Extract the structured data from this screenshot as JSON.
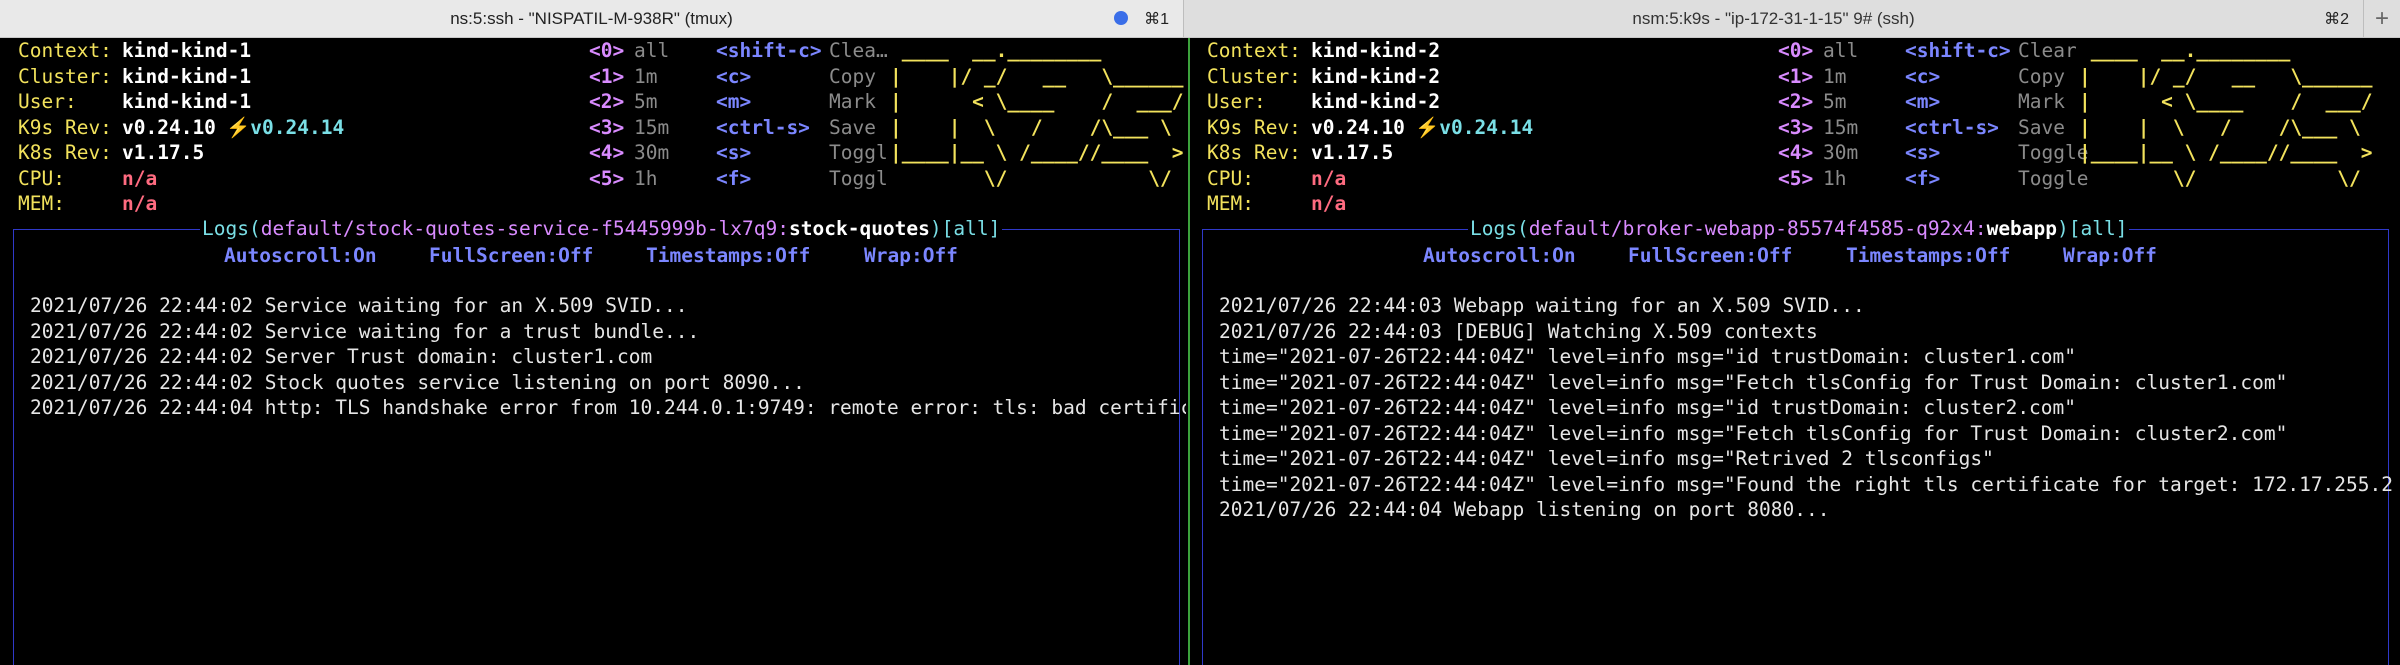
{
  "tabs": [
    {
      "title": "ns:5:ssh - \"NISPATIL-M-938R\" (tmux)",
      "key": "⌘1"
    },
    {
      "title": "nsm:5:k9s - \"ip-172-31-1-15\" 9# (ssh)",
      "key": "⌘2"
    }
  ],
  "new_tab": "+",
  "colors": {
    "accent_yellow": "#f2e25c",
    "menu_blue": "#7b86ff",
    "frame_blue": "#2f39c9",
    "error_red": "#ff6b80",
    "cyan": "#7adfe6",
    "divider_green": "#3ca23c"
  },
  "labels": {
    "context": "Context:",
    "cluster": "Cluster:",
    "user": "User:",
    "k9s_rev": "K9s Rev:",
    "k8s_rev": "K8s Rev:",
    "cpu": "CPU:",
    "mem": "MEM:"
  },
  "logo_lines": [
    " ____  __.________",
    "|    |/ _/   __   \\______",
    "|      < \\____    /  ___/",
    "|    |  \\   /    /\\___ \\",
    "|____|__ \\ /____//____  >",
    "        \\/            \\/"
  ],
  "status": {
    "autoscroll": "Autoscroll:On",
    "fullscreen": "FullScreen:Off",
    "timestamps": "Timestamps:Off",
    "wrap": "Wrap:Off"
  },
  "panes": [
    {
      "context": "kind-kind-1",
      "cluster": "kind-kind-1",
      "user": "kind-kind-1",
      "k9s_rev": "v0.24.10",
      "k9s_latest": "⚡️v0.24.14",
      "k8s_rev": "v1.17.5",
      "cpu": "n/a",
      "mem": "n/a",
      "ns_keys": [
        {
          "key": "<0>",
          "label": "all"
        },
        {
          "key": "<1>",
          "label": "1m"
        },
        {
          "key": "<2>",
          "label": "5m"
        },
        {
          "key": "<3>",
          "label": "15m"
        },
        {
          "key": "<4>",
          "label": "30m"
        },
        {
          "key": "<5>",
          "label": "1h"
        }
      ],
      "actions": [
        {
          "key": "<shift-c>",
          "label": "Clea…"
        },
        {
          "key": "<c>",
          "label": "Copy"
        },
        {
          "key": "<m>",
          "label": "Mark"
        },
        {
          "key": "<ctrl-s>",
          "label": "Save"
        },
        {
          "key": "<s>",
          "label": "Toggl"
        },
        {
          "key": "<f>",
          "label": "Toggl"
        }
      ],
      "log_prefix": "Logs(",
      "log_path": "default/stock-quotes-service-f5445999b-lx7q9:",
      "log_container": "stock-quotes",
      "log_suffix": ")",
      "log_filter": "[all]",
      "logs": [
        "2021/07/26 22:44:02 Service waiting for an X.509 SVID...",
        "2021/07/26 22:44:02 Service waiting for a trust bundle...",
        "2021/07/26 22:44:02 Server Trust domain: cluster1.com",
        "2021/07/26 22:44:02 Stock quotes service listening on port 8090...",
        "2021/07/26 22:44:04 http: TLS handshake error from 10.244.0.1:9749: remote error: tls: bad certific"
      ]
    },
    {
      "context": "kind-kind-2",
      "cluster": "kind-kind-2",
      "user": "kind-kind-2",
      "k9s_rev": "v0.24.10",
      "k9s_latest": "⚡️v0.24.14",
      "k8s_rev": "v1.17.5",
      "cpu": "n/a",
      "mem": "n/a",
      "ns_keys": [
        {
          "key": "<0>",
          "label": "all"
        },
        {
          "key": "<1>",
          "label": "1m"
        },
        {
          "key": "<2>",
          "label": "5m"
        },
        {
          "key": "<3>",
          "label": "15m"
        },
        {
          "key": "<4>",
          "label": "30m"
        },
        {
          "key": "<5>",
          "label": "1h"
        }
      ],
      "actions": [
        {
          "key": "<shift-c>",
          "label": "Clear"
        },
        {
          "key": "<c>",
          "label": "Copy"
        },
        {
          "key": "<m>",
          "label": "Mark"
        },
        {
          "key": "<ctrl-s>",
          "label": "Save"
        },
        {
          "key": "<s>",
          "label": "Toggle"
        },
        {
          "key": "<f>",
          "label": "Toggle"
        }
      ],
      "log_prefix": "Logs(",
      "log_path": "default/broker-webapp-85574f4585-q92x4:",
      "log_container": "webapp",
      "log_suffix": ")",
      "log_filter": "[all]",
      "logs": [
        "2021/07/26 22:44:03 Webapp waiting for an X.509 SVID...",
        "2021/07/26 22:44:03 [DEBUG] Watching X.509 contexts",
        "time=\"2021-07-26T22:44:04Z\" level=info msg=\"id trustDomain: cluster1.com\"",
        "time=\"2021-07-26T22:44:04Z\" level=info msg=\"Fetch tlsConfig for Trust Domain: cluster1.com\"",
        "time=\"2021-07-26T22:44:04Z\" level=info msg=\"id trustDomain: cluster2.com\"",
        "time=\"2021-07-26T22:44:04Z\" level=info msg=\"Fetch tlsConfig for Trust Domain: cluster2.com\"",
        "time=\"2021-07-26T22:44:04Z\" level=info msg=\"Retrived 2 tlsconfigs\"",
        "time=\"2021-07-26T22:44:04Z\" level=info msg=\"Found the right tls certificate for target: 172.17.255.2",
        "2021/07/26 22:44:04 Webapp listening on port 8080..."
      ]
    }
  ]
}
